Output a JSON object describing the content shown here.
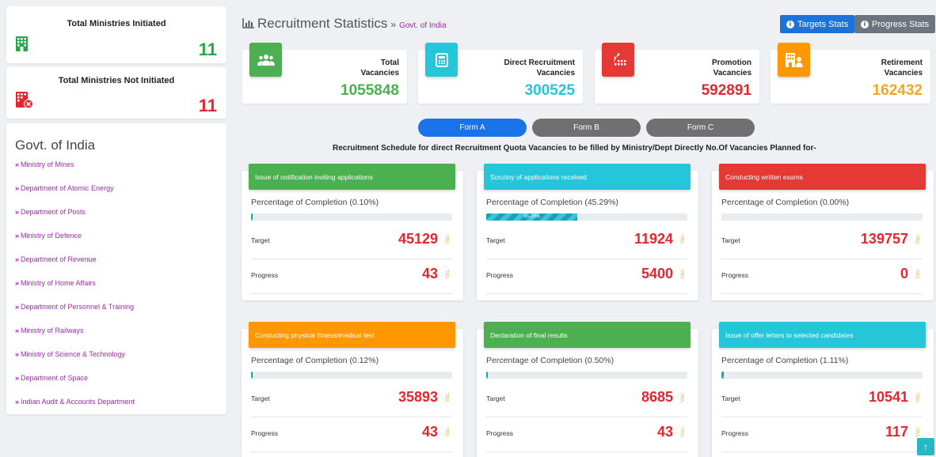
{
  "sidebar": {
    "initiated": {
      "title": "Total Ministries Initiated",
      "count": "11",
      "color": "#28a745"
    },
    "not_initiated": {
      "title": "Total Ministries Not Initiated",
      "count": "11",
      "color": "#e5262e"
    },
    "list_heading": "Govt. of India",
    "items": [
      "Ministry of Mines",
      "Department of Atomic Energy",
      "Department of Posts",
      "Ministry of Defence",
      "Department of Revenue",
      "Ministry of Home Affairs",
      "Department of Personnel & Training",
      "Ministry of Railways",
      "Ministry of Science & Technology",
      "Department of Space",
      "Indian Audit & Accounts Department"
    ]
  },
  "header": {
    "title": "Recruitment Statistics",
    "separator": "»",
    "subtitle": "Govt. of India",
    "targets_btn": "Targets Stats",
    "progress_btn": "Progress Stats"
  },
  "vacancies": [
    {
      "label_line1": "Total",
      "label_line2": "Vacancies",
      "value": "1055848",
      "color": "#4caf50",
      "icon": "group-icon"
    },
    {
      "label_line1": "Direct Recruitment",
      "label_line2": "Vacancies",
      "value": "300525",
      "color": "#26c6da",
      "icon": "document-icon"
    },
    {
      "label_line1": "Promotion",
      "label_line2": "Vacancies",
      "value": "592891",
      "color": "#e53935",
      "icon": "promotion-icon"
    },
    {
      "label_line1": "Retirement",
      "label_line2": "Vacancies",
      "value": "162432",
      "color": "#ff9800",
      "icon": "retirement-icon"
    }
  ],
  "tabs": [
    {
      "label": "Form A",
      "active": true
    },
    {
      "label": "Form B",
      "active": false
    },
    {
      "label": "Form C",
      "active": false
    }
  ],
  "schedule_title": "Recruitment Schedule for direct Recruitment Quota Vacancies to be filled by Ministry/Dept Directly No.Of Vacancies Planned for-",
  "row_labels": {
    "target": "Target",
    "progress": "Progress",
    "unit": "Vac."
  },
  "tasks": [
    {
      "title": "Issue of notification inviting applications",
      "pct_text": "Percentage of Completion (0.10%)",
      "pct": 0.1,
      "bar_label": "",
      "target": "45129",
      "progress": "43",
      "color": "#4caf50"
    },
    {
      "title": "Scrutiny of applications received",
      "pct_text": "Percentage of Completion (45.29%)",
      "pct": 45.29,
      "bar_label": "45.29%",
      "target": "11924",
      "progress": "5400",
      "color": "#26c6da"
    },
    {
      "title": "Conducting written exams",
      "pct_text": "Percentage of Completion (0.00%)",
      "pct": 0.0,
      "bar_label": "",
      "target": "139757",
      "progress": "0",
      "color": "#e53935"
    },
    {
      "title": "Conducting physical fitness/medical test",
      "pct_text": "Percentage of Completion (0.12%)",
      "pct": 0.12,
      "bar_label": "",
      "target": "35893",
      "progress": "43",
      "color": "#ff9800"
    },
    {
      "title": "Declaration of final results",
      "pct_text": "Percentage of Completion (0.50%)",
      "pct": 0.5,
      "bar_label": "",
      "target": "8685",
      "progress": "43",
      "color": "#4caf50"
    },
    {
      "title": "Issue of offer letters to selected candidates",
      "pct_text": "Percentage of Completion (1.11%)",
      "pct": 1.11,
      "bar_label": "",
      "target": "10541",
      "progress": "117",
      "color": "#26c6da"
    }
  ]
}
